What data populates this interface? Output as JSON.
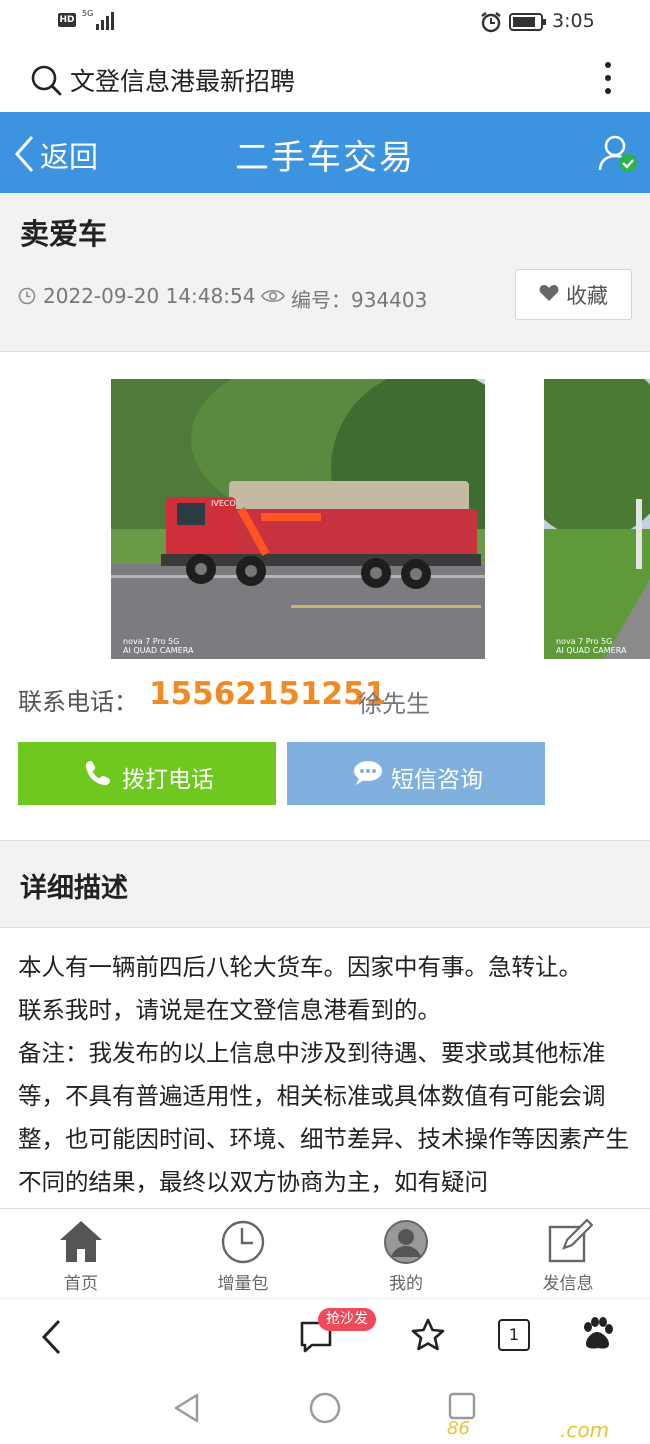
{
  "status_bar": {
    "network_badge": "HD",
    "network_gen": "5G",
    "time": "3:05"
  },
  "search_bar": {
    "query": "文登信息港最新招聘"
  },
  "header": {
    "back_label": "返回",
    "title": "二手车交易"
  },
  "post": {
    "title": "卖爱车",
    "datetime": "2022-09-20 14:48:54",
    "id_label": "编号：934403",
    "favorite_label": "收藏"
  },
  "photos": {
    "camera_watermark_line1": "nova 7 Pro 5G",
    "camera_watermark_line2": "AI QUAD CAMERA",
    "truck_brand": "IVECO"
  },
  "contact": {
    "label": "联系电话：",
    "phone": "15562151251",
    "name": "徐先生",
    "call_button": "拨打电话",
    "sms_button": "短信咨询"
  },
  "description": {
    "section_title": "详细描述",
    "paragraphs": [
      "本人有一辆前四后八轮大货车。因家中有事。急转让。",
      "联系我时，请说是在文登信息港看到的。",
      "备注：我发布的以上信息中涉及到待遇、要求或其他标准等，不具有普遍适用性，相关标准或具体数值有可能会调整，也可能因时间、环境、细节差异、技术操作等因素产生不同的结果，最终以双方协商为主，如有疑问"
    ]
  },
  "bottom_nav": {
    "items": [
      {
        "label": "首页",
        "icon": "home-icon"
      },
      {
        "label": "增量包",
        "icon": "clock-icon"
      },
      {
        "label": "我的",
        "icon": "user-avatar-icon"
      },
      {
        "label": "发信息",
        "icon": "edit-icon"
      }
    ]
  },
  "browser_bar": {
    "promo_badge": "抢沙发",
    "tab_count": "1"
  },
  "watermark": {
    "left": "86",
    "right": ".com"
  },
  "colors": {
    "header_blue": "#3c93e0",
    "call_green": "#6ec81e",
    "sms_blue": "#7fb0de",
    "phone_orange": "#f08a24",
    "promo_red": "#f04a5a"
  }
}
